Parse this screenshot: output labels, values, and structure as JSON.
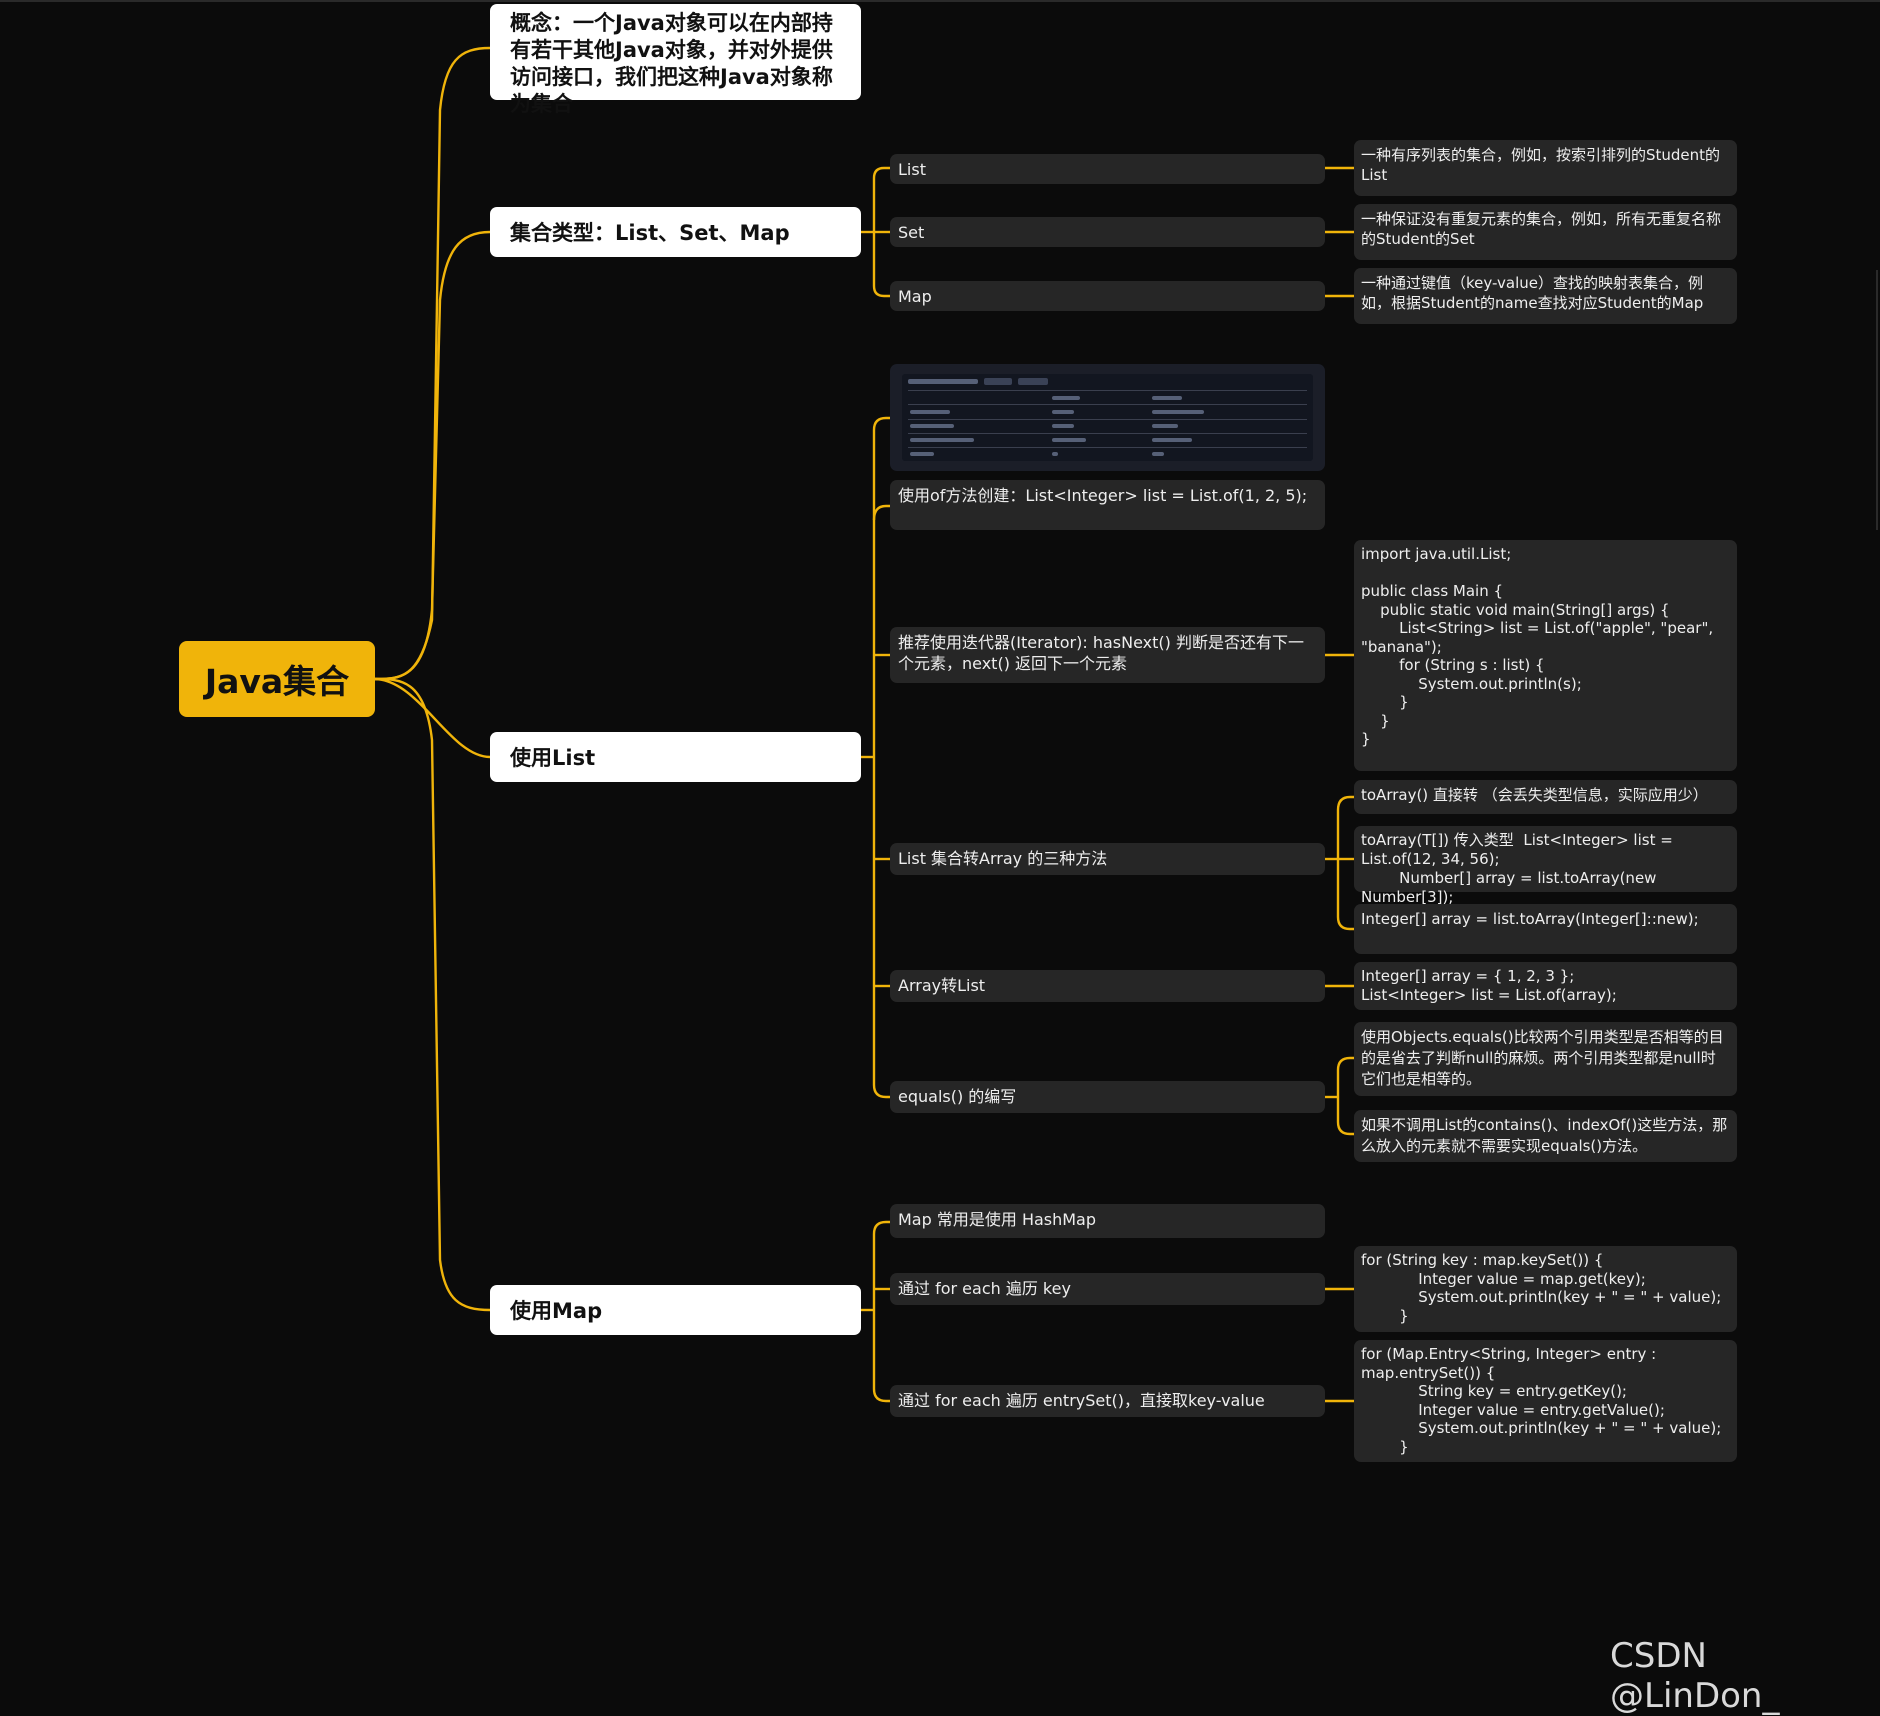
{
  "root": {
    "label": "Java集合"
  },
  "concept": {
    "label": "概念：一个Java对象可以在内部持有若干其他Java对象，并对外提供访问接口，我们把这种Java对象称为集合"
  },
  "types": {
    "label": "集合类型：List、Set、Map",
    "items": [
      {
        "label": "List",
        "desc": "一种有序列表的集合，例如，按索引排列的Student的List"
      },
      {
        "label": "Set",
        "desc": "一种保证没有重复元素的集合，例如，所有无重复名称的Student的Set"
      },
      {
        "label": "Map",
        "desc": "一种通过键值（key-value）查找的映射表集合，例如，根据Student的name查找对应Student的Map"
      }
    ]
  },
  "use_list": {
    "label": "使用List",
    "create_of": "使用of方法创建：List<Integer> list = List.of(1, 2, 5);",
    "iterator": "推荐使用迭代器(Iterator): hasNext() 判断是否还有下一个元素，next() 返回下一个元素",
    "iterator_code": "import java.util.List;\n\npublic class Main {\n    public static void main(String[] args) {\n        List<String> list = List.of(\"apple\", \"pear\",\n\"banana\");\n        for (String s : list) {\n            System.out.println(s);\n        }\n    }\n}",
    "to_array": "List 集合转Array 的三种方法",
    "to_array_methods": [
      "toArray() 直接转  （会丢失类型信息，实际应用少）",
      "toArray(T[]) 传入类型  List<Integer> list = List.of(12, 34, 56);\n        Number[] array = list.toArray(new Number[3]);",
      "Integer[] array = list.toArray(Integer[]::new);"
    ],
    "array_to_list": "Array转List",
    "array_to_list_code": "Integer[] array = { 1, 2, 3 };\nList<Integer> list = List.of(array);",
    "equals": "equals() 的编写",
    "equals_notes": [
      "使用Objects.equals()比较两个引用类型是否相等的目的是省去了判断null的麻烦。两个引用类型都是null时它们也是相等的。",
      "如果不调用List的contains()、indexOf()这些方法，那么放入的元素就不需要实现equals()方法。"
    ]
  },
  "use_map": {
    "label": "使用Map",
    "common": "Map 常用是使用 HashMap",
    "foreach_key": "通过 for each 遍历 key",
    "foreach_key_code": "for (String key : map.keySet()) {\n            Integer value = map.get(key);\n            System.out.println(key + \" = \" + value);\n        }",
    "foreach_entry": "通过 for each 遍历 entrySet()，直接取key-value",
    "foreach_entry_code": "for (Map.Entry<String, Integer> entry :\nmap.entrySet()) {\n            String key = entry.getKey();\n            Integer value = entry.getValue();\n            System.out.println(key + \" = \" + value);\n        }"
  },
  "watermark": "CSDN @LinDon_",
  "colors": {
    "accent": "#f0b40a",
    "background": "#0b0b0b",
    "node_dark": "#262626",
    "node_light": "#ffffff"
  }
}
